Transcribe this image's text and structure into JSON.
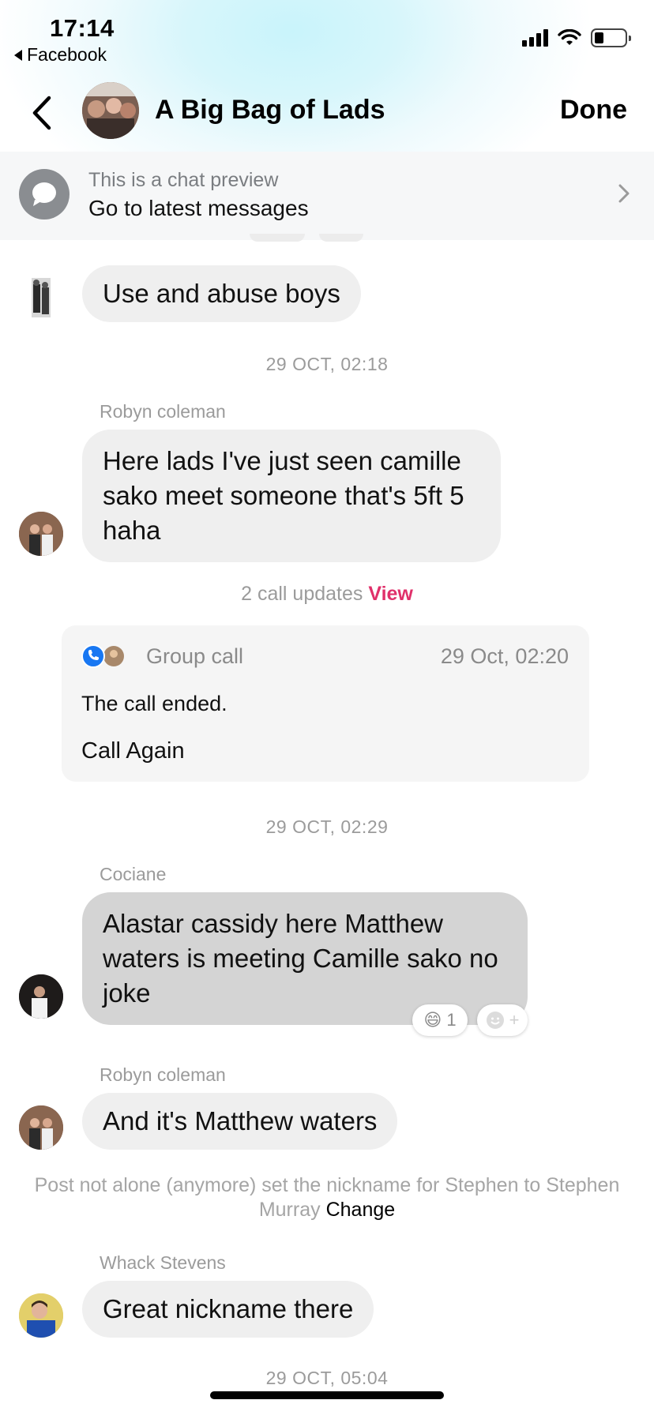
{
  "status_bar": {
    "time": "17:14",
    "back_app": "Facebook"
  },
  "header": {
    "title": "A Big Bag of Lads",
    "done_label": "Done"
  },
  "preview_banner": {
    "subtitle": "This is a chat preview",
    "action": "Go to latest messages"
  },
  "messages": {
    "m1": {
      "text": "Use and abuse boys"
    },
    "ts1": "29 OCT, 02:18",
    "m2": {
      "sender": "Robyn coleman",
      "text": "Here lads I've just seen camille sako meet someone that's 5ft 5 haha"
    },
    "call_updates": {
      "text": "2 call updates",
      "link": "View"
    },
    "call_card": {
      "label": "Group call",
      "time": "29 Oct, 02:20",
      "status": "The call ended.",
      "action": "Call Again"
    },
    "ts2": "29 OCT, 02:29",
    "m3": {
      "sender": "Cociane",
      "text": "Alastar cassidy here Matthew waters is meeting Camille sako no joke",
      "reaction_emoji": "😄",
      "reaction_count": "1",
      "add_reaction": "+"
    },
    "m4": {
      "sender": "Robyn coleman",
      "text": "And it's Matthew waters"
    },
    "nickname_note": {
      "text": "Post not alone (anymore) set the nickname for Stephen to Stephen Murray",
      "link": "Change"
    },
    "m5": {
      "sender": "Whack Stevens",
      "text": "Great nickname there"
    },
    "ts3": "29 OCT, 05:04"
  },
  "colors": {
    "accent_link": "#e0306a",
    "bubble": "#efefef",
    "bubble_highlight": "#d4d4d4",
    "call_blue": "#1877f2"
  }
}
